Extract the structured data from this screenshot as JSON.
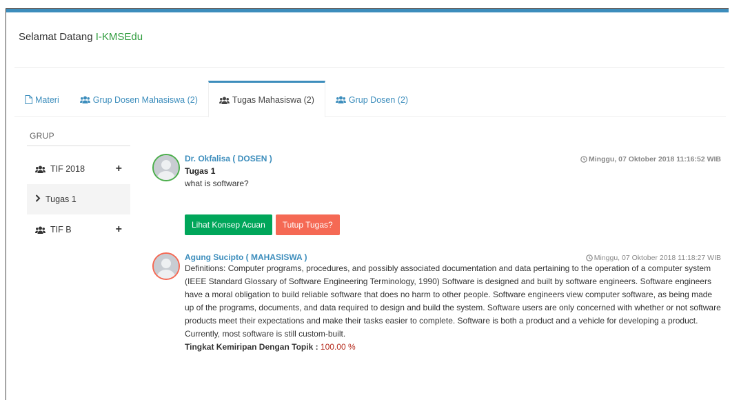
{
  "header": {
    "welcome_prefix": "Selamat Datang ",
    "brand": "I-KMSEdu"
  },
  "tabs": [
    {
      "label": "Materi",
      "icon": "file-icon"
    },
    {
      "label": "Grup Dosen Mahasiswa (2)",
      "icon": "users-icon"
    },
    {
      "label": "Tugas Mahasiswa (2)",
      "icon": "users-icon",
      "active": true
    },
    {
      "label": "Grup Dosen (2)",
      "icon": "users-icon"
    }
  ],
  "sidebar": {
    "title": "GRUP",
    "items": [
      {
        "label": "TIF 2018",
        "icon": "users-icon",
        "action": "+"
      },
      {
        "label": "Tugas 1",
        "icon": "chevron-right-icon",
        "active": true
      },
      {
        "label": "TIF B",
        "icon": "users-icon",
        "action": "+"
      }
    ]
  },
  "posts": [
    {
      "author": "Dr. Okfalisa ( DOSEN )",
      "timestamp": "Minggu, 07 Oktober 2018 11:16:52 WIB",
      "title": "Tugas 1",
      "text": "what is software?",
      "buttons": {
        "primary": "Lihat Konsep Acuan",
        "secondary": "Tutup Tugas?"
      }
    },
    {
      "author": "Agung Sucipto ( MAHASISWA )",
      "timestamp": "Minggu, 07 Oktober 2018 11:18:27 WIB",
      "text": "Definitions: Computer programs, procedures, and possibly associated documentation and data pertaining to the operation of a computer system (IEEE Standard Glossary of Software Engineering Terminology, 1990) Software is designed and built by software engineers. Software engineers have a moral obligation to build reliable software that does no harm to other people. Software engineers view computer software, as being made up of the programs, documents, and data required to design and build the system. Software users are only concerned with whether or not software products meet their expectations and make their tasks easier to complete. Software is both a product and a vehicle for developing a product. Currently, most software is still custom-built.",
      "similarity_label": "Tingkat Kemiripan Dengan Topik : ",
      "similarity_value": "100.00 %"
    }
  ],
  "colors": {
    "accent": "#3c8dbc",
    "brand": "#2f9c3d",
    "success": "#00a65a",
    "danger": "#f56954"
  }
}
